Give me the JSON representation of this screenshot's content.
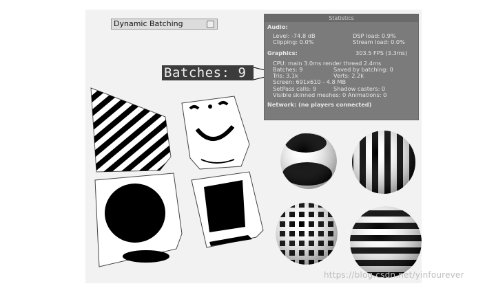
{
  "toggle": {
    "label": "Dynamic Batching",
    "checked": false
  },
  "stats": {
    "title": "Statistics",
    "audio_header": "Audio:",
    "level": "Level: -74.8 dB",
    "dsp_load": "DSP load: 0.9%",
    "clipping": "Clipping: 0.0%",
    "stream_load": "Stream load: 0.0%",
    "graphics_header": "Graphics:",
    "fps": "303.5 FPS (3.3ms)",
    "cpu": "CPU: main 3.0ms  render thread 2.4ms",
    "batches": "Batches: 9",
    "saved_by_batching": "Saved by batching: 0",
    "tris": "Tris: 3.1k",
    "verts": "Verts: 2.2k",
    "screen": "Screen: 691x610 - 4.8 MB",
    "setpass": "SetPass calls: 9",
    "shadow_casters": "Shadow casters: 0",
    "skinned": "Visible skinned meshes: 0  Animations: 0",
    "network": "Network: (no players connected)"
  },
  "callout": {
    "text": "Batches: 9"
  },
  "watermark": "https://blog.csdn.net/yinfourever",
  "colors": {
    "panel": "#7b7b7b",
    "callout_bg": "#3c3c3c",
    "stripe": "#000000"
  }
}
